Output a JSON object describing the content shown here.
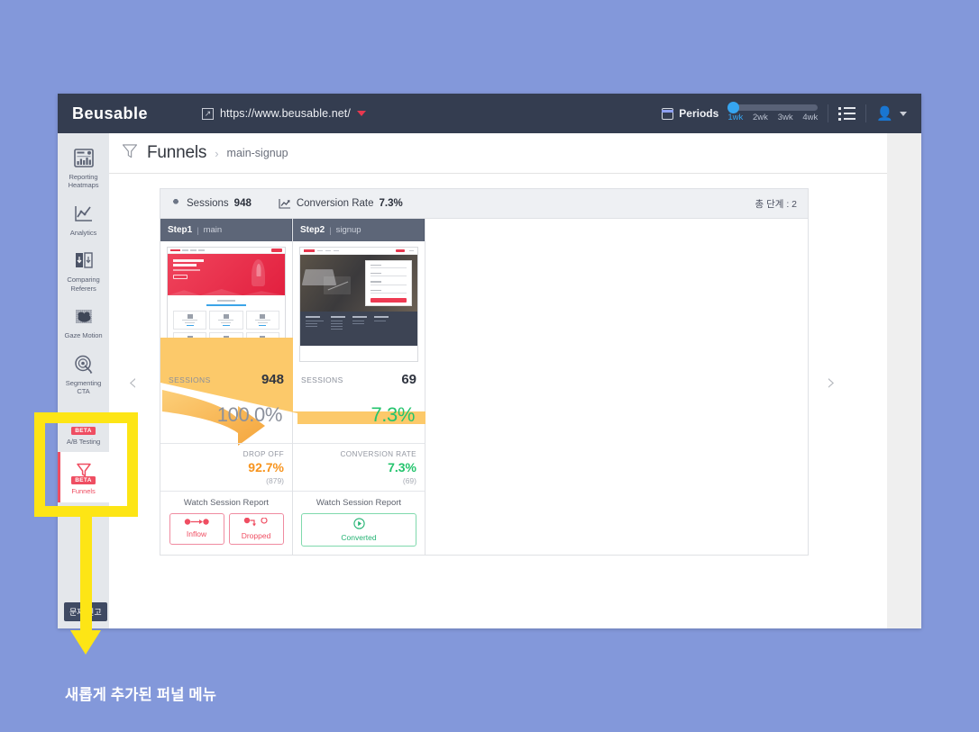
{
  "topbar": {
    "brand": "Beusable",
    "url": "https://www.beusable.net/",
    "ext_icon": "external-link-icon",
    "url_caret": "caret-down-icon",
    "periods_label": "Periods",
    "calendar_icon": "calendar-icon",
    "slider_ticks": [
      "1wk",
      "2wk",
      "3wk",
      "4wk"
    ],
    "slider_selected": "1wk",
    "list_icon": "list-view-icon",
    "user_icon": "user-avatar-icon",
    "user_caret": "caret-down-icon"
  },
  "sidebar": {
    "items": [
      {
        "label": "Reporting\nHeatmaps",
        "line1": "Reporting",
        "line2": "Heatmaps",
        "icon": "heatmap-report-icon",
        "beta": false,
        "active": false
      },
      {
        "label": "Analytics",
        "line1": "Analytics",
        "line2": "",
        "icon": "analytics-chart-icon",
        "beta": false,
        "active": false
      },
      {
        "label": "Comparing Referers",
        "line1": "Comparing",
        "line2": "Referers",
        "icon": "comparing-referers-icon",
        "beta": false,
        "active": false
      },
      {
        "label": "Gaze Motion",
        "line1": "Gaze Motion",
        "line2": "",
        "icon": "gaze-motion-icon",
        "beta": false,
        "active": false
      },
      {
        "label": "Segmenting CTA",
        "line1": "Segmenting",
        "line2": "CTA",
        "icon": "segmenting-cta-icon",
        "beta": false,
        "active": false
      },
      {
        "label": "A/B Testing",
        "line1": "A/B Testing",
        "line2": "",
        "icon": "ab-testing-icon",
        "beta": true,
        "active": false
      },
      {
        "label": "Funnels",
        "line1": "Funnels",
        "line2": "",
        "icon": "funnel-icon",
        "beta": true,
        "active": true
      }
    ],
    "beta_badge": "BETA",
    "report_button": "문제 신고"
  },
  "breadcrumb": {
    "icon": "funnel-icon",
    "title": "Funnels",
    "separator": "›",
    "current": "main-signup"
  },
  "funnel_card": {
    "sessions_label": "Sessions",
    "sessions_value": "948",
    "sessions_icon": "sessions-icon",
    "conversion_label": "Conversion Rate",
    "conversion_value": "7.3%",
    "conversion_icon": "trend-up-icon",
    "total_steps": "총 단계 : 2",
    "prev_icon": "chevron-left-icon",
    "next_icon": "chevron-right-icon",
    "steps": [
      {
        "name": "Step1",
        "divider": "|",
        "page": "main",
        "sessions_label": "SESSIONS",
        "sessions_value": "948",
        "percent": "100.0%",
        "percent_color": "#8c919c",
        "metric_label": "DROP OFF",
        "metric_value": "92.7%",
        "metric_sub": "(879)",
        "metric_color": "#f7941e",
        "watch_label": "Watch Session Report",
        "buttons": [
          {
            "label": "Inflow",
            "icon": "inflow-icon",
            "style": "pink"
          },
          {
            "label": "Dropped",
            "icon": "dropped-icon",
            "style": "pink"
          }
        ]
      },
      {
        "name": "Step2",
        "divider": "|",
        "page": "signup",
        "sessions_label": "SESSIONS",
        "sessions_value": "69",
        "percent": "7.3%",
        "percent_color": "#24c46d",
        "metric_label": "CONVERSION RATE",
        "metric_value": "7.3%",
        "metric_sub": "(69)",
        "metric_color": "#24c46d",
        "watch_label": "Watch Session Report",
        "buttons": [
          {
            "label": "Converted",
            "icon": "converted-play-icon",
            "style": "green"
          }
        ]
      }
    ]
  },
  "annotation": {
    "caption": "새롭게 추가된 퍼널 메뉴",
    "highlight_color": "#fde515",
    "background_color": "#8398da"
  },
  "colors": {
    "topbar": "#343d50",
    "accent_pink": "#ef4e62",
    "accent_green": "#24c46d",
    "accent_orange": "#f7941e",
    "slider_blue": "#36a5f0",
    "funnel_wedge": "#fcc96a"
  }
}
